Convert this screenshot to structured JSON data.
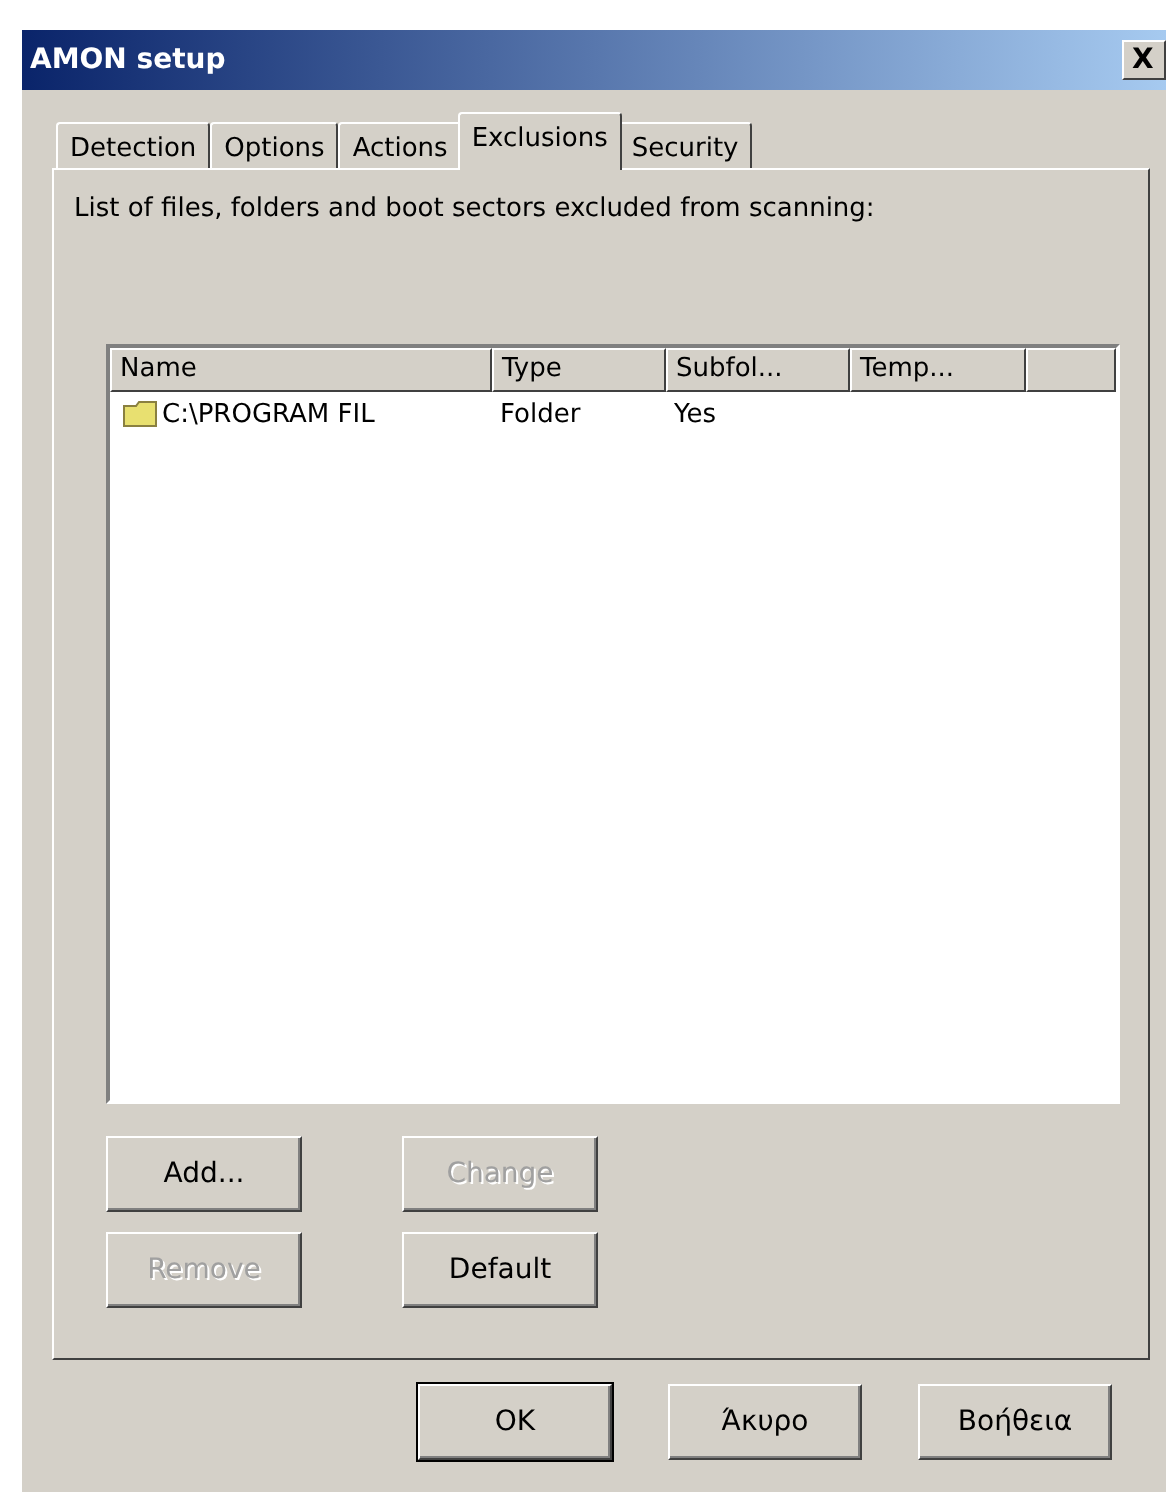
{
  "window": {
    "title": "AMON setup",
    "close": "X"
  },
  "tabs": [
    {
      "label": "Detection",
      "selected": false
    },
    {
      "label": "Options",
      "selected": false
    },
    {
      "label": "Actions",
      "selected": false
    },
    {
      "label": "Exclusions",
      "selected": true
    },
    {
      "label": "Security",
      "selected": false
    }
  ],
  "description": "List of files, folders and boot sectors excluded from scanning:",
  "list": {
    "columns": [
      "Name",
      "Type",
      "Subfol...",
      "Temp..."
    ],
    "rows": [
      {
        "cells": [
          "C:\\PROGRAM FIL",
          "Folder",
          "Yes"
        ]
      }
    ]
  },
  "list_buttons": [
    {
      "label": "Add...",
      "disabled": false
    },
    {
      "label": "Change",
      "disabled": true
    },
    {
      "label": "Remove",
      "disabled": true
    },
    {
      "label": "Default",
      "disabled": false
    }
  ],
  "dialog_buttons": [
    {
      "label": "OK",
      "default": true
    },
    {
      "label": "Άκυρο",
      "default": false
    },
    {
      "label": "Βοήθεια",
      "default": false
    }
  ]
}
